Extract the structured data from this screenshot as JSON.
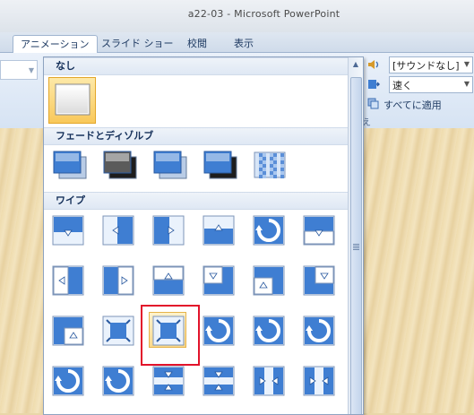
{
  "window": {
    "title": "a22-03 - Microsoft PowerPoint"
  },
  "tabs": [
    {
      "label": "アニメーション",
      "active": true
    },
    {
      "label": "スライド ショー",
      "active": false
    },
    {
      "label": "校閲",
      "active": false
    },
    {
      "label": "表示",
      "active": false
    }
  ],
  "ribbon": {
    "sound_dropdown": {
      "value": "[サウンドなし]"
    },
    "speed_dropdown": {
      "value": "速く"
    },
    "apply_all_label": "すべてに適用",
    "group_label_fragment": "え"
  },
  "gallery": {
    "sections": [
      {
        "header": "なし",
        "items": [
          "none"
        ]
      },
      {
        "header": "フェードとディゾルブ",
        "items": [
          "fade-smooth",
          "fade-through-black",
          "cut",
          "cut-through-black",
          "dissolve"
        ]
      },
      {
        "header": "ワイプ",
        "items": [
          "wipe-down",
          "wipe-left",
          "wipe-right",
          "wipe-up",
          "wheel-clockwise",
          "uncover-down",
          "uncover-left",
          "uncover-right",
          "uncover-up",
          "uncover-left-down",
          "uncover-left-up",
          "uncover-right-down",
          "uncover-right-up",
          "box-in",
          "box-out",
          "wheel-1",
          "wheel-2",
          "wheel-3",
          "wheel-4",
          "wheel-8",
          "split-horizontal-in",
          "split-horizontal-out",
          "split-vertical-in",
          "split-vertical-out"
        ]
      }
    ],
    "selected_item": "none",
    "highlighted_item": "box-out"
  },
  "colors": {
    "accent_selected": "#f9c85a",
    "highlight_red": "#e2132a",
    "tile_blue": "#3f7ed2"
  }
}
